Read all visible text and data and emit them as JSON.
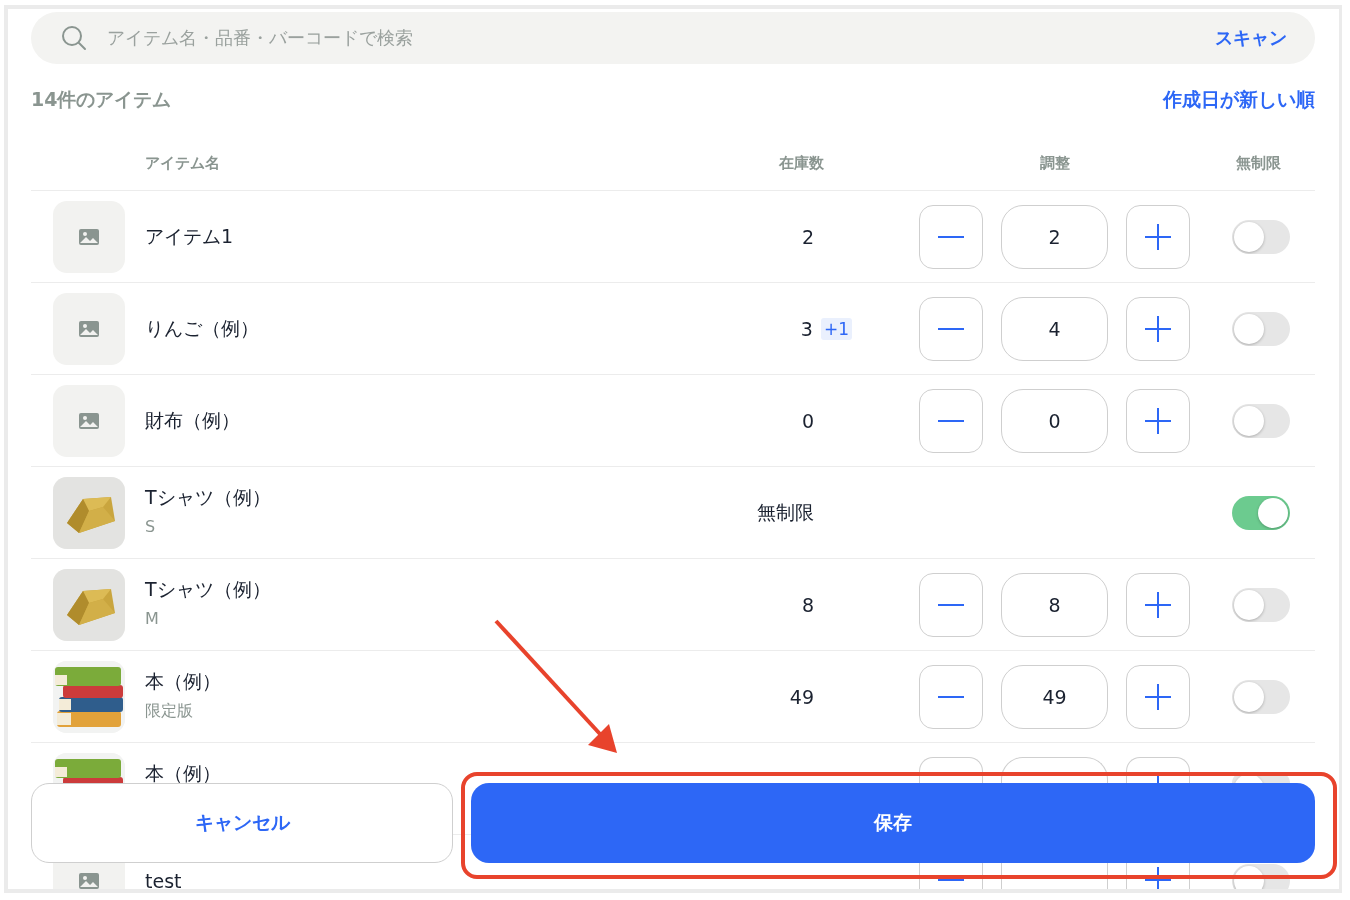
{
  "search": {
    "placeholder": "アイテム名・品番・バーコードで検索",
    "scan_label": "スキャン"
  },
  "summary": {
    "count_label": "14件のアイテム",
    "sort_label": "作成日が新しい順"
  },
  "table": {
    "columns": [
      "アイテム名",
      "在庫数",
      "調整",
      "無制限"
    ],
    "rows": [
      {
        "kind": "single-line",
        "thumbnail": {
          "kind": "placeholder"
        },
        "name": "アイテム1",
        "stock": "2",
        "quantity": "2",
        "unlimited": false
      },
      {
        "kind": "single-line",
        "thumbnail": {
          "kind": "placeholder"
        },
        "name": "りんご（例）",
        "stock": "3",
        "stock_delta": "+1",
        "quantity": "4",
        "unlimited": false
      },
      {
        "kind": "single-line",
        "thumbnail": {
          "kind": "placeholder"
        },
        "name": "財布（例）",
        "stock": "0",
        "quantity": "0",
        "unlimited": false
      },
      {
        "kind": "two-line",
        "name": "Tシャツ（例）",
        "variant": "S",
        "stock": "無制限",
        "unlimited": true
      },
      {
        "kind": "two-line",
        "name": "Tシャツ（例）",
        "variant": "M",
        "stock": "8",
        "quantity": "8",
        "unlimited": false
      },
      {
        "kind": "two-line",
        "name": "本（例）",
        "variant": "限定版",
        "stock": "49",
        "quantity": "49",
        "unlimited": false
      },
      {
        "kind": "two-line",
        "name": "本（例）",
        "unlimited": false
      },
      {
        "kind": "single-line",
        "thumbnail": {
          "kind": "placeholder"
        },
        "name": "test",
        "unlimited": false
      }
    ]
  },
  "footer": {
    "buttons": [
      {
        "label": "キャンセル",
        "kind": "secondary"
      },
      {
        "label": "保存",
        "kind": "primary"
      }
    ]
  }
}
